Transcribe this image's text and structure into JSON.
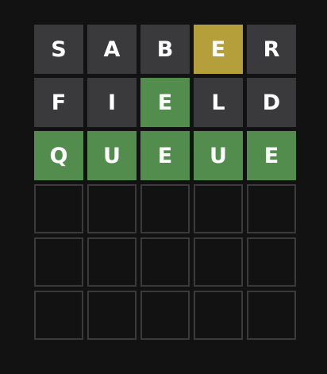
{
  "colors": {
    "background": "#121213",
    "absent": "#3a3a3c",
    "present": "#b59f3b",
    "correct": "#538d4e",
    "empty_border": "#3a3a3c",
    "letter": "#ffffff"
  },
  "board": {
    "rows": [
      {
        "tiles": [
          {
            "letter": "S",
            "state": "absent"
          },
          {
            "letter": "A",
            "state": "absent"
          },
          {
            "letter": "B",
            "state": "absent"
          },
          {
            "letter": "E",
            "state": "present"
          },
          {
            "letter": "R",
            "state": "absent"
          }
        ]
      },
      {
        "tiles": [
          {
            "letter": "F",
            "state": "absent"
          },
          {
            "letter": "I",
            "state": "absent"
          },
          {
            "letter": "E",
            "state": "correct"
          },
          {
            "letter": "L",
            "state": "absent"
          },
          {
            "letter": "D",
            "state": "absent"
          }
        ]
      },
      {
        "tiles": [
          {
            "letter": "Q",
            "state": "correct"
          },
          {
            "letter": "U",
            "state": "correct"
          },
          {
            "letter": "E",
            "state": "correct"
          },
          {
            "letter": "U",
            "state": "correct"
          },
          {
            "letter": "E",
            "state": "correct"
          }
        ]
      },
      {
        "tiles": [
          {
            "letter": "",
            "state": "empty"
          },
          {
            "letter": "",
            "state": "empty"
          },
          {
            "letter": "",
            "state": "empty"
          },
          {
            "letter": "",
            "state": "empty"
          },
          {
            "letter": "",
            "state": "empty"
          }
        ]
      },
      {
        "tiles": [
          {
            "letter": "",
            "state": "empty"
          },
          {
            "letter": "",
            "state": "empty"
          },
          {
            "letter": "",
            "state": "empty"
          },
          {
            "letter": "",
            "state": "empty"
          },
          {
            "letter": "",
            "state": "empty"
          }
        ]
      },
      {
        "tiles": [
          {
            "letter": "",
            "state": "empty"
          },
          {
            "letter": "",
            "state": "empty"
          },
          {
            "letter": "",
            "state": "empty"
          },
          {
            "letter": "",
            "state": "empty"
          },
          {
            "letter": "",
            "state": "empty"
          }
        ]
      }
    ]
  }
}
